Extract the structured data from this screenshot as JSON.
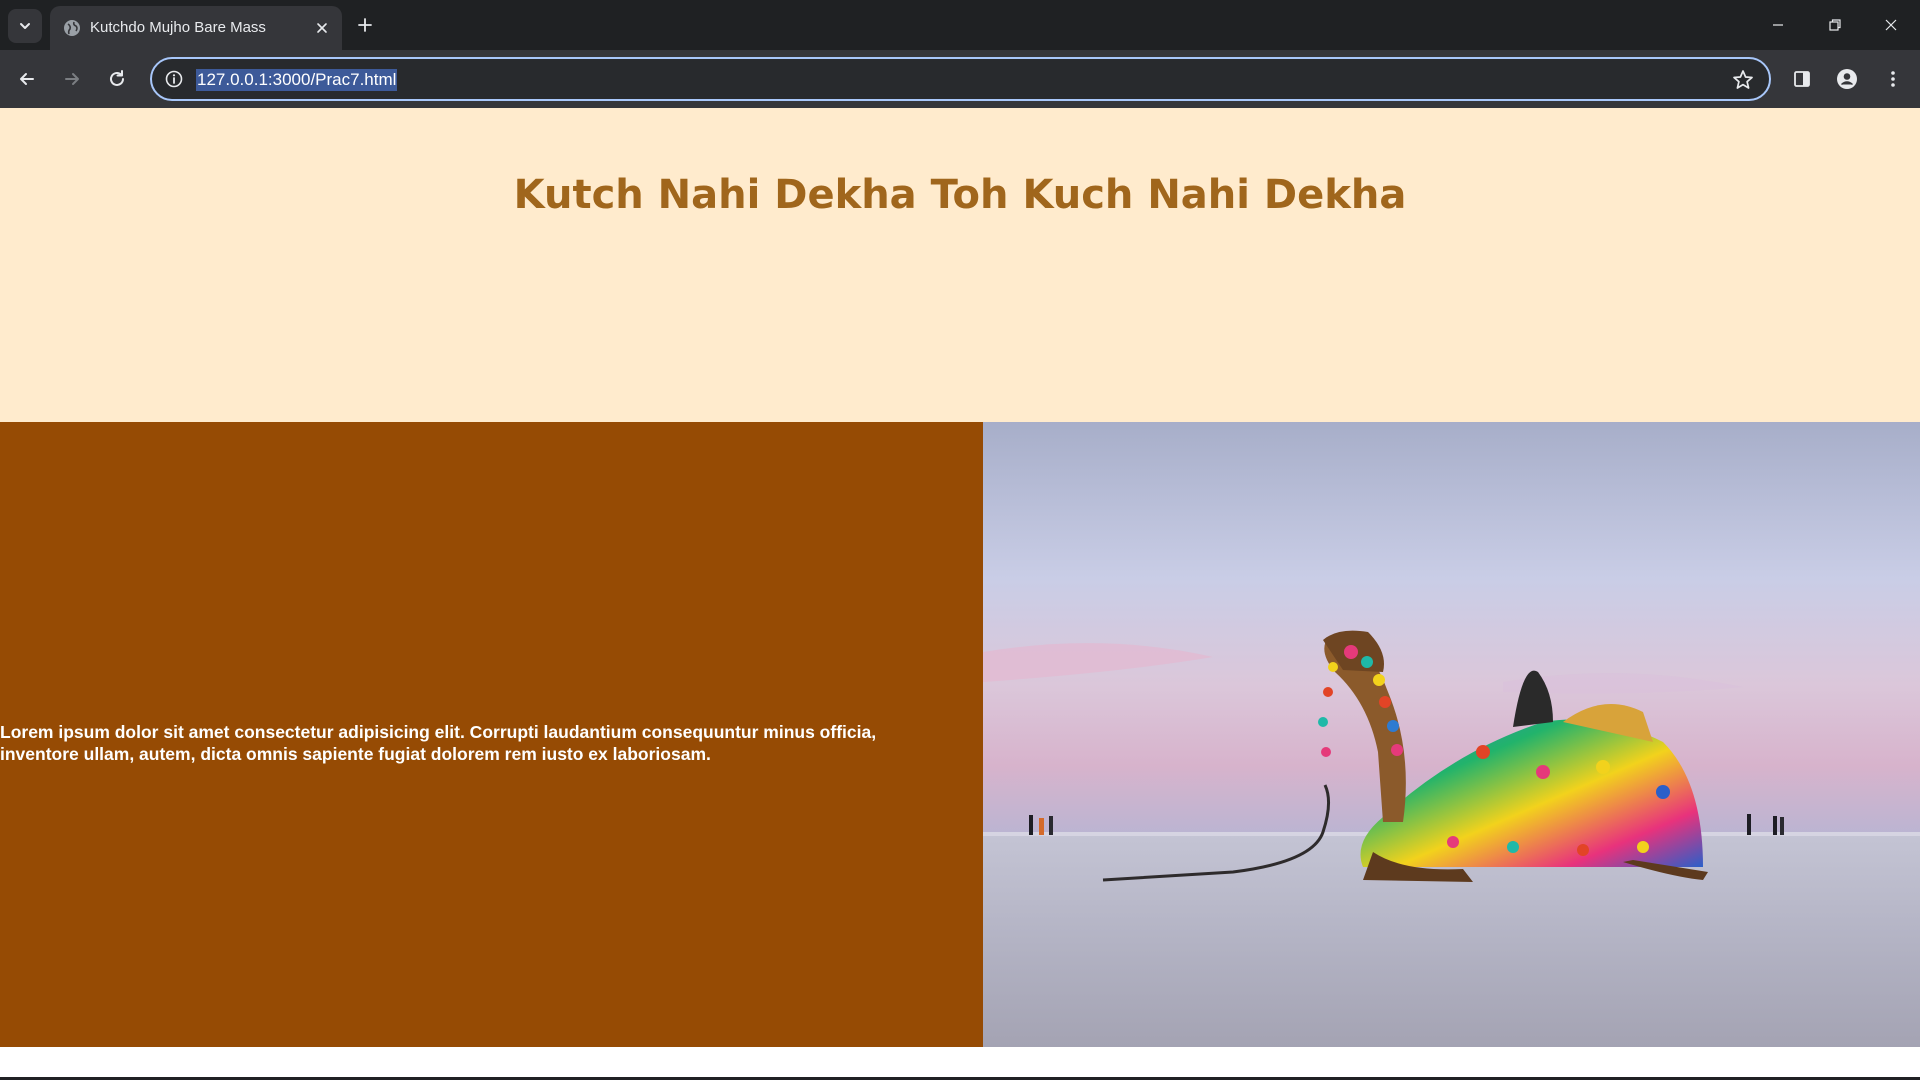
{
  "browser": {
    "tab_title": "Kutchdo Mujho Bare Mass",
    "url": "127.0.0.1:3000/Prac7.html",
    "icons": {
      "tab_search": "chevron-down-icon",
      "favicon": "globe-icon",
      "tab_close": "close-icon",
      "new_tab": "plus-icon",
      "back": "arrow-left-icon",
      "forward": "arrow-right-icon",
      "reload": "reload-icon",
      "site_info": "info-icon",
      "bookmark": "star-icon",
      "side_panel": "side-panel-icon",
      "profile": "profile-icon",
      "menu": "kebab-menu-icon",
      "minimize": "minimize-icon",
      "restore": "restore-icon",
      "close_window": "close-icon"
    },
    "colors": {
      "frame": "#1f2123",
      "toolbar": "#35363a",
      "omnibox_focus": "#a8c7fa"
    }
  },
  "page": {
    "heading": "Kutch Nahi Dekha Toh Kuch Nahi Dekha",
    "paragraph": "Lorem ipsum dolor sit amet consectetur adipisicing elit. Corrupti laudantium consequuntur minus officia, inventore ullam, autem, dicta omnis sapiente fugiat dolorem rem iusto ex laboriosam.",
    "image": "decorated camel resting on white salt desert at dusk",
    "colors": {
      "hero_background": "#ffebcd",
      "heading": "#a0661c",
      "text_panel": "#964b04",
      "text": "#ffffff"
    }
  }
}
